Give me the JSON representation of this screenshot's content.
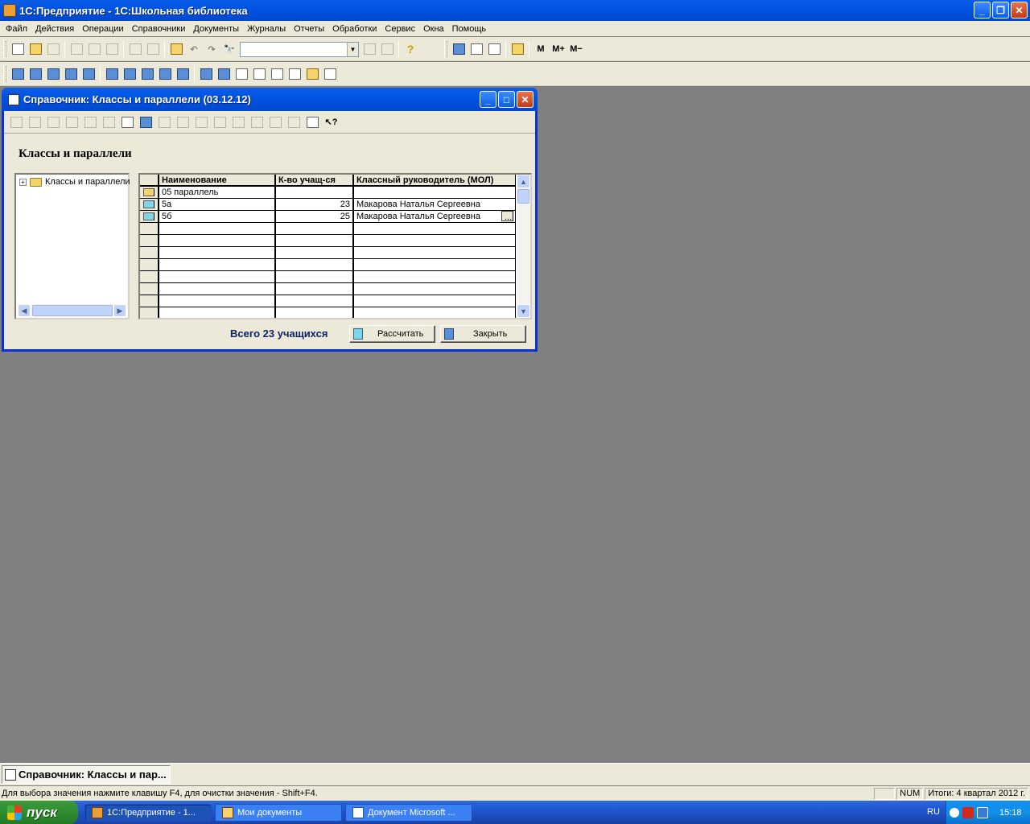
{
  "app": {
    "title": "1С:Предприятие - 1С:Школьная библиотека"
  },
  "menu": [
    "Файл",
    "Действия",
    "Операции",
    "Справочники",
    "Документы",
    "Журналы",
    "Отчеты",
    "Обработки",
    "Сервис",
    "Окна",
    "Помощь"
  ],
  "toolbar": {
    "search_value": "",
    "m_label": "M",
    "mplus_label": "M+",
    "mminus_label": "M−"
  },
  "child": {
    "title": "Справочник: Классы и параллели (03.12.12)",
    "heading": "Классы и параллели",
    "tree": {
      "root_label": "Классы и параллели"
    },
    "grid": {
      "columns": [
        "Наименование",
        "К-во учащ-ся",
        "Классный руководитель (МОЛ)"
      ],
      "rows": [
        {
          "name": "05 параллель",
          "count": "",
          "teacher": ""
        },
        {
          "name": "5а",
          "count": "23",
          "teacher": "Макарова  Наталья Сергеевна"
        },
        {
          "name": "5б",
          "count": "25",
          "teacher": "Макарова  Наталья Сергеевна"
        }
      ],
      "ellipsis": "..."
    },
    "total_text": "Всего 23 учащихся",
    "calc_button": "Рассчитать",
    "close_button": "Закрыть"
  },
  "window_tab": "Справочник: Классы и пар...",
  "status": {
    "message": "Для выбора значения нажмите клавишу F4, для очистки значения - Shift+F4.",
    "num": "NUM",
    "totals": "Итоги: 4 квартал 2012 г."
  },
  "taskbar": {
    "start": "пуск",
    "tasks": [
      "1С:Предприятие - 1...",
      "Мои документы",
      "Документ Microsoft ..."
    ],
    "lang": "RU",
    "clock": "15:18"
  }
}
